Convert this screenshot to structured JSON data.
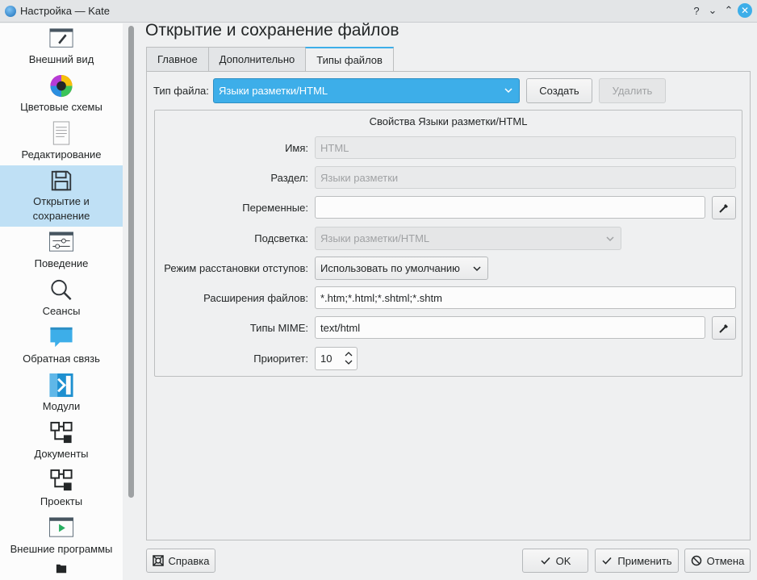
{
  "window": {
    "title": "Настройка — Kate",
    "buttons": {
      "help": "?",
      "minimize": "⌄",
      "maximize": "⌃",
      "close": "✕"
    }
  },
  "sidebar": {
    "items": [
      {
        "label": "Внешний вид",
        "icon": "paintbrush-icon"
      },
      {
        "label": "Цветовые схемы",
        "icon": "color-wheel-icon"
      },
      {
        "label": "Редактирование",
        "icon": "document-edit-icon"
      },
      {
        "label": "Открытие и сохранение",
        "icon": "floppy-disk-icon",
        "active": true
      },
      {
        "label": "Поведение",
        "icon": "settings-sliders-icon"
      },
      {
        "label": "Сеансы",
        "icon": "search-icon"
      },
      {
        "label": "Обратная связь",
        "icon": "speech-bubble-icon"
      },
      {
        "label": "Модули",
        "icon": "plugin-icon"
      },
      {
        "label": "Документы",
        "icon": "hierarchy-icon"
      },
      {
        "label": "Проекты",
        "icon": "hierarchy-icon"
      },
      {
        "label": "Внешние программы",
        "icon": "play-window-icon"
      }
    ]
  },
  "page": {
    "title": "Открытие и сохранение файлов",
    "tabs": [
      {
        "label": "Главное"
      },
      {
        "label": "Дополнительно"
      },
      {
        "label": "Типы файлов",
        "active": true
      }
    ]
  },
  "filetype": {
    "label": "Тип файла:",
    "selected": "Языки разметки/HTML",
    "create_label": "Создать",
    "delete_label": "Удалить"
  },
  "properties": {
    "title": "Свойства Языки разметки/HTML",
    "name_label": "Имя:",
    "name_value": "HTML",
    "section_label": "Раздел:",
    "section_value": "Языки разметки",
    "variables_label": "Переменные:",
    "variables_value": "",
    "highlight_label": "Подсветка:",
    "highlight_value": "Языки разметки/HTML",
    "indent_label": "Режим расстановки отступов:",
    "indent_value": "Использовать по умолчанию",
    "extensions_label": "Расширения файлов:",
    "extensions_value": "*.htm;*.html;*.shtml;*.shtm",
    "mime_label": "Типы MIME:",
    "mime_value": "text/html",
    "priority_label": "Приоритет:",
    "priority_value": "10"
  },
  "footer": {
    "help_label": "Справка",
    "ok_label": "OK",
    "apply_label": "Применить",
    "cancel_label": "Отмена"
  },
  "colors": {
    "accent": "#3daee9",
    "selection": "#bfe0f5"
  }
}
